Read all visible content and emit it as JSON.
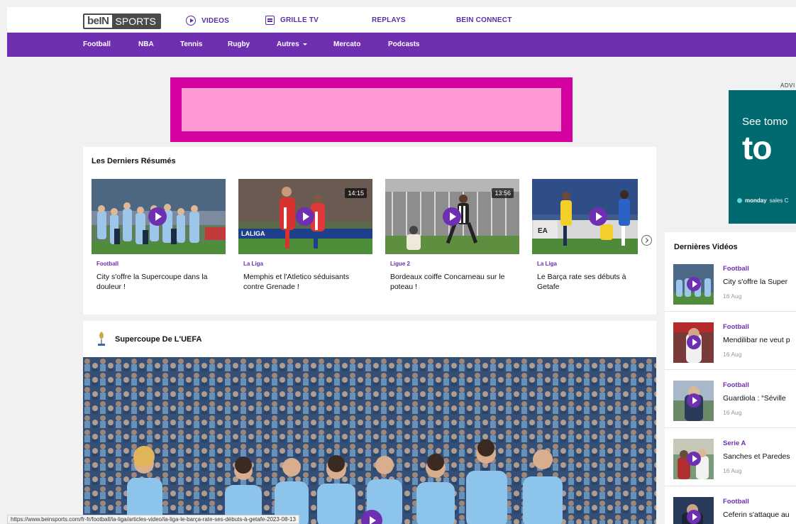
{
  "header": {
    "logo_left": "beIN",
    "logo_right": "SPORTS",
    "nav": [
      {
        "label": "VIDEOS"
      },
      {
        "label": "GRILLE TV"
      },
      {
        "label": "REPLAYS"
      },
      {
        "label": "BEIN CONNECT"
      }
    ]
  },
  "subnav": [
    "Football",
    "NBA",
    "Tennis",
    "Rugby",
    "Autres",
    "Mercato",
    "Podcasts"
  ],
  "resumes": {
    "title": "Les Derniers Résumés",
    "cards": [
      {
        "category": "Football",
        "title": "City s'offre la Supercoupe dans la douleur !",
        "duration": ""
      },
      {
        "category": "La Liga",
        "title": "Memphis et l'Atletico séduisants contre Grenade !",
        "duration": "14:15"
      },
      {
        "category": "Ligue 2",
        "title": "Bordeaux coiffe Concarneau sur le poteau !",
        "duration": "13:56"
      },
      {
        "category": "La Liga",
        "title": "Le Barça rate ses débuts à Getafe",
        "duration": ""
      }
    ]
  },
  "supercoupe": {
    "title": "Supercoupe De L'UEFA"
  },
  "ad_right": {
    "label": "ADVI",
    "line1": "See tomo",
    "line2": "to",
    "brand": "monday",
    "brand_rest": "sales C"
  },
  "dernieres_videos": {
    "title": "Dernières Vidéos",
    "items": [
      {
        "category": "Football",
        "title": "City s'offre la Super",
        "date": "16 Aug"
      },
      {
        "category": "Football",
        "title": "Mendilibar ne veut p",
        "date": "16 Aug"
      },
      {
        "category": "Football",
        "title": "Guardiola : “Séville",
        "date": "16 Aug"
      },
      {
        "category": "Serie A",
        "title": "Sanches et Paredes",
        "date": "16 Aug"
      },
      {
        "category": "Football",
        "title": "Ceferin s'attaque au",
        "date": ""
      }
    ]
  },
  "status_url": "https://www.beinsports.com/fr-fr/football/la-liga/articles-video/la-liga-le-barça-rate-ses-débuts-à-getafe-2023-08-13"
}
